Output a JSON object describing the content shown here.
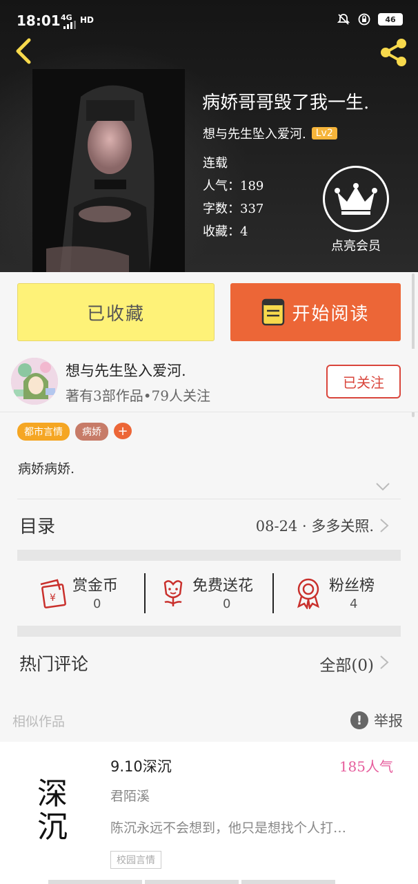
{
  "status": {
    "time": "18:01",
    "network": "4G",
    "hd": "HD",
    "battery": "46"
  },
  "book": {
    "title": "病娇哥哥毁了我一生.",
    "author": "想与先生坠入爱河.",
    "level": "Lv2",
    "status": "连载",
    "popularity_label": "人气：189",
    "words_label": "字数：337",
    "favorites_label": "收藏：4",
    "vip_label": "点亮会员"
  },
  "actions": {
    "favorited_label": "已收藏",
    "read_label": "开始阅读"
  },
  "author_card": {
    "name": "想与先生坠入爱河.",
    "summary": "著有3部作品•79人关注",
    "follow_label": "已关注"
  },
  "tags": [
    {
      "label": "都市言情",
      "color": "#f5a623"
    },
    {
      "label": "病娇",
      "color": "#c77b68"
    }
  ],
  "tag_add": "+",
  "description": "病娇病娇.",
  "toc": {
    "label": "目录",
    "latest": "08-24 · 多多关照."
  },
  "stats": [
    {
      "label": "赏金币",
      "value": "0",
      "icon": "red-envelope-icon"
    },
    {
      "label": "免费送花",
      "value": "0",
      "icon": "flower-icon"
    },
    {
      "label": "粉丝榜",
      "value": "4",
      "icon": "medal-icon"
    }
  ],
  "comments": {
    "label": "热门评论",
    "all_label": "全部(0)"
  },
  "similar": {
    "heading": "相似作品",
    "report_label": "举报",
    "item": {
      "cover_text": "深沉",
      "title": "9.10深沉",
      "popularity": "185人气",
      "author": "君陌溪",
      "desc": "陈沉永远不会想到，他只是想找个人打…",
      "tag": "校园言情"
    }
  },
  "colors": {
    "accent_orange": "#ec6637",
    "accent_yellow": "#fef278",
    "follow_red": "#d9453b",
    "pink": "#e65c9c"
  }
}
